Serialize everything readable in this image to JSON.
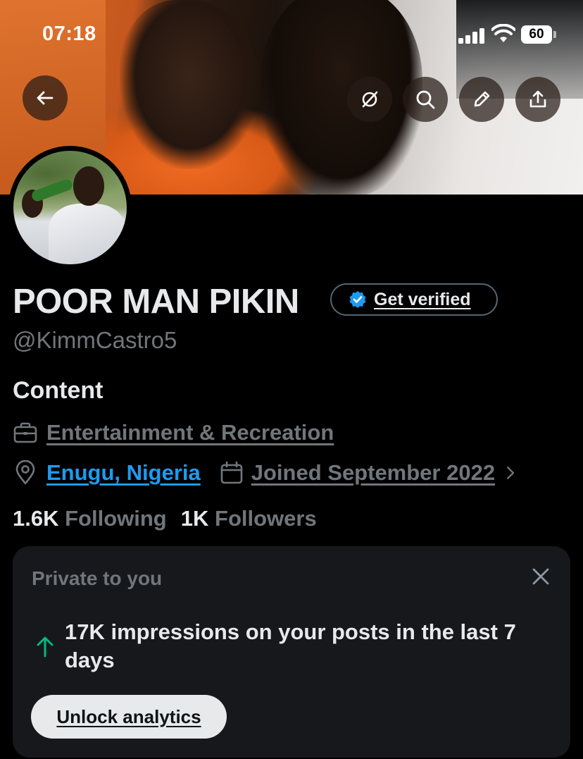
{
  "status_bar": {
    "time": "07:18",
    "battery": "60"
  },
  "banner": {
    "buttons": {
      "back": "back-arrow-icon",
      "circles": "grok-circle-icon",
      "search": "search-icon",
      "edit": "pencil-icon",
      "share": "share-icon"
    }
  },
  "profile": {
    "name": "POOR MAN PIKIN",
    "verify_label": "Get verified",
    "handle": "@KimmCastro5",
    "bio": "Content",
    "category": "Entertainment & Recreation",
    "location": "Enugu, Nigeria",
    "joined": "Joined September 2022",
    "following_count": "1.6K",
    "following_label": "Following",
    "followers_count": "1K",
    "followers_label": "Followers"
  },
  "card": {
    "title": "Private to you",
    "message": "17K impressions on your posts in the last 7 days",
    "button": "Unlock analytics"
  },
  "colors": {
    "background": "#000000",
    "link_blue": "#1d9bf0",
    "muted": "#71767b",
    "card_bg": "#16181c",
    "up_arrow": "#00ba7c"
  }
}
